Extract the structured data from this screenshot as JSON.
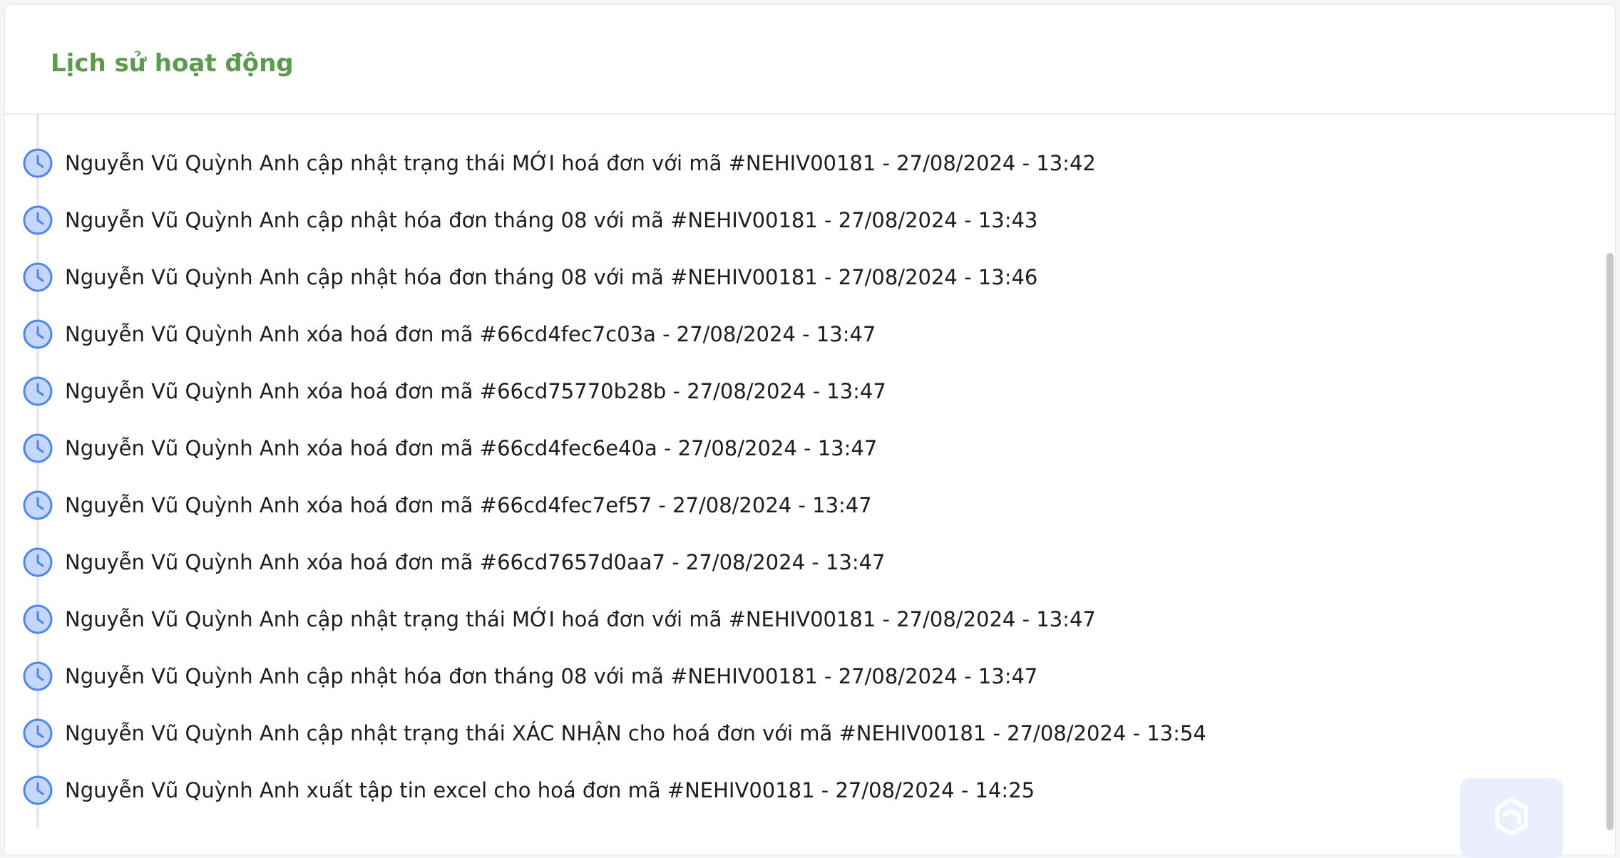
{
  "panel": {
    "title": "Lịch sử hoạt động"
  },
  "colors": {
    "title": "#5d9a4e",
    "clock_fill": "#c5d7f9",
    "clock_stroke": "#4e86ea",
    "timeline_line": "#e3e8f1",
    "text": "#1c1d21",
    "widget_bg": "#ebeeff"
  },
  "icons": {
    "activity": "clock-icon",
    "help_widget": "help-widget-icon"
  },
  "activities": [
    {
      "text": "Nguyễn Vũ Quỳnh Anh cập nhật trạng thái MỚI hoá đơn với mã #NEHIV00181 - 27/08/2024 - 13:42"
    },
    {
      "text": "Nguyễn Vũ Quỳnh Anh cập nhật hóa đơn tháng 08 với mã #NEHIV00181 - 27/08/2024 - 13:43"
    },
    {
      "text": "Nguyễn Vũ Quỳnh Anh cập nhật hóa đơn tháng 08 với mã #NEHIV00181 - 27/08/2024 - 13:46"
    },
    {
      "text": "Nguyễn Vũ Quỳnh Anh xóa hoá đơn mã #66cd4fec7c03a - 27/08/2024 - 13:47"
    },
    {
      "text": "Nguyễn Vũ Quỳnh Anh xóa hoá đơn mã #66cd75770b28b - 27/08/2024 - 13:47"
    },
    {
      "text": "Nguyễn Vũ Quỳnh Anh xóa hoá đơn mã #66cd4fec6e40a - 27/08/2024 - 13:47"
    },
    {
      "text": "Nguyễn Vũ Quỳnh Anh xóa hoá đơn mã #66cd4fec7ef57 - 27/08/2024 - 13:47"
    },
    {
      "text": "Nguyễn Vũ Quỳnh Anh xóa hoá đơn mã #66cd7657d0aa7 - 27/08/2024 - 13:47"
    },
    {
      "text": "Nguyễn Vũ Quỳnh Anh cập nhật trạng thái MỚI hoá đơn với mã #NEHIV00181 - 27/08/2024 - 13:47"
    },
    {
      "text": "Nguyễn Vũ Quỳnh Anh cập nhật hóa đơn tháng 08 với mã #NEHIV00181 - 27/08/2024 - 13:47"
    },
    {
      "text": "Nguyễn Vũ Quỳnh Anh cập nhật trạng thái XÁC NHẬN cho hoá đơn với mã #NEHIV00181 - 27/08/2024 - 13:54"
    },
    {
      "text": "Nguyễn Vũ Quỳnh Anh xuất tập tin excel cho hoá đơn mã #NEHIV00181 - 27/08/2024 - 14:25"
    }
  ]
}
